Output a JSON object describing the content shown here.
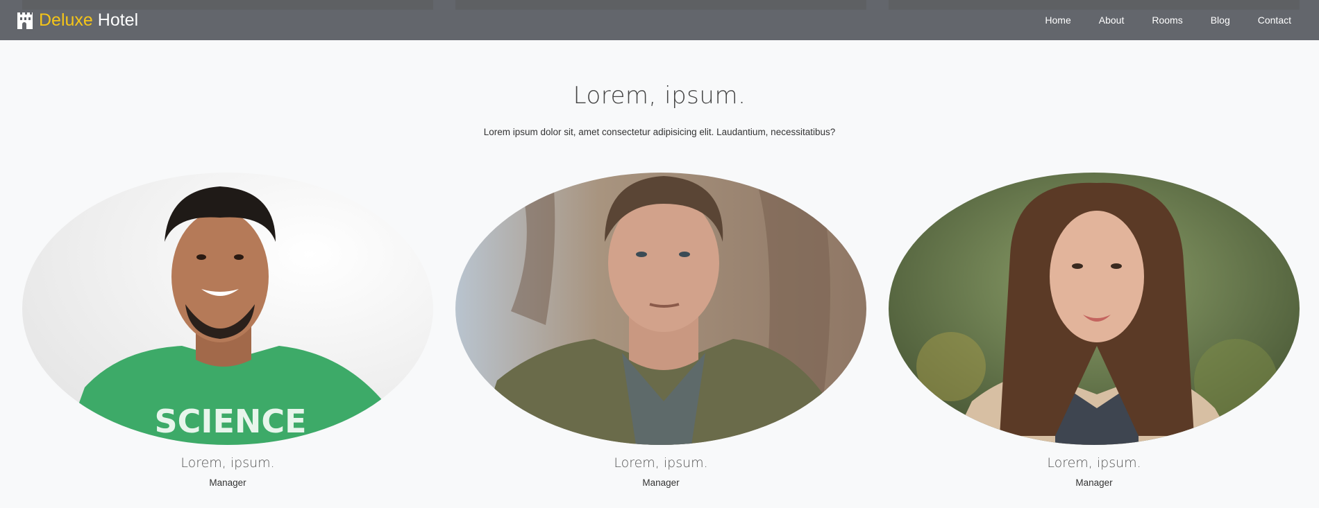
{
  "brand": {
    "accent": "Deluxe",
    "rest": "Hotel",
    "accent_color": "#f5c518",
    "icon": "castle-icon"
  },
  "nav": [
    "Home",
    "About",
    "Rooms",
    "Blog",
    "Contact"
  ],
  "section": {
    "title": "Lorem, ipsum.",
    "subtitle": "Lorem ipsum dolor sit, amet consectetur adipisicing elit. Laudantium, necessitatibus?"
  },
  "team": [
    {
      "name": "Lorem, ipsum.",
      "role": "Manager",
      "photo": "man-green-shirt-photo"
    },
    {
      "name": "Lorem, ipsum.",
      "role": "Manager",
      "photo": "man-jacket-photo"
    },
    {
      "name": "Lorem, ipsum.",
      "role": "Manager",
      "photo": "woman-portrait-photo"
    }
  ],
  "colors": {
    "navbar": "#5d6066",
    "background": "#f8f9fa",
    "strip": "#7a6a2d"
  }
}
